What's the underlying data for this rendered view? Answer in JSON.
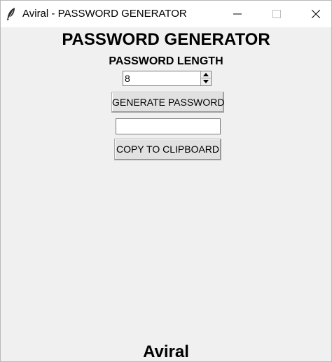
{
  "window": {
    "title": "Aviral - PASSWORD GENERATOR",
    "controls": [
      "minimize",
      "maximize",
      "close"
    ]
  },
  "app": {
    "heading": "PASSWORD GENERATOR",
    "length_label": "PASSWORD LENGTH",
    "length_value": "8",
    "generate_button": "GENERATE PASSWORD",
    "password_output": "",
    "copy_button": "COPY TO CLIPBOARD",
    "footer": "Aviral"
  },
  "icons": {
    "app": "feather-icon",
    "minimize": "minimize-icon",
    "maximize": "maximize-icon",
    "close": "close-icon",
    "spin_up": "arrow-up-icon",
    "spin_down": "arrow-down-icon"
  },
  "colors": {
    "window_background": "#f0f0f0",
    "titlebar_background": "#ffffff",
    "button_background": "#e1e1e1",
    "text": "#000000"
  }
}
